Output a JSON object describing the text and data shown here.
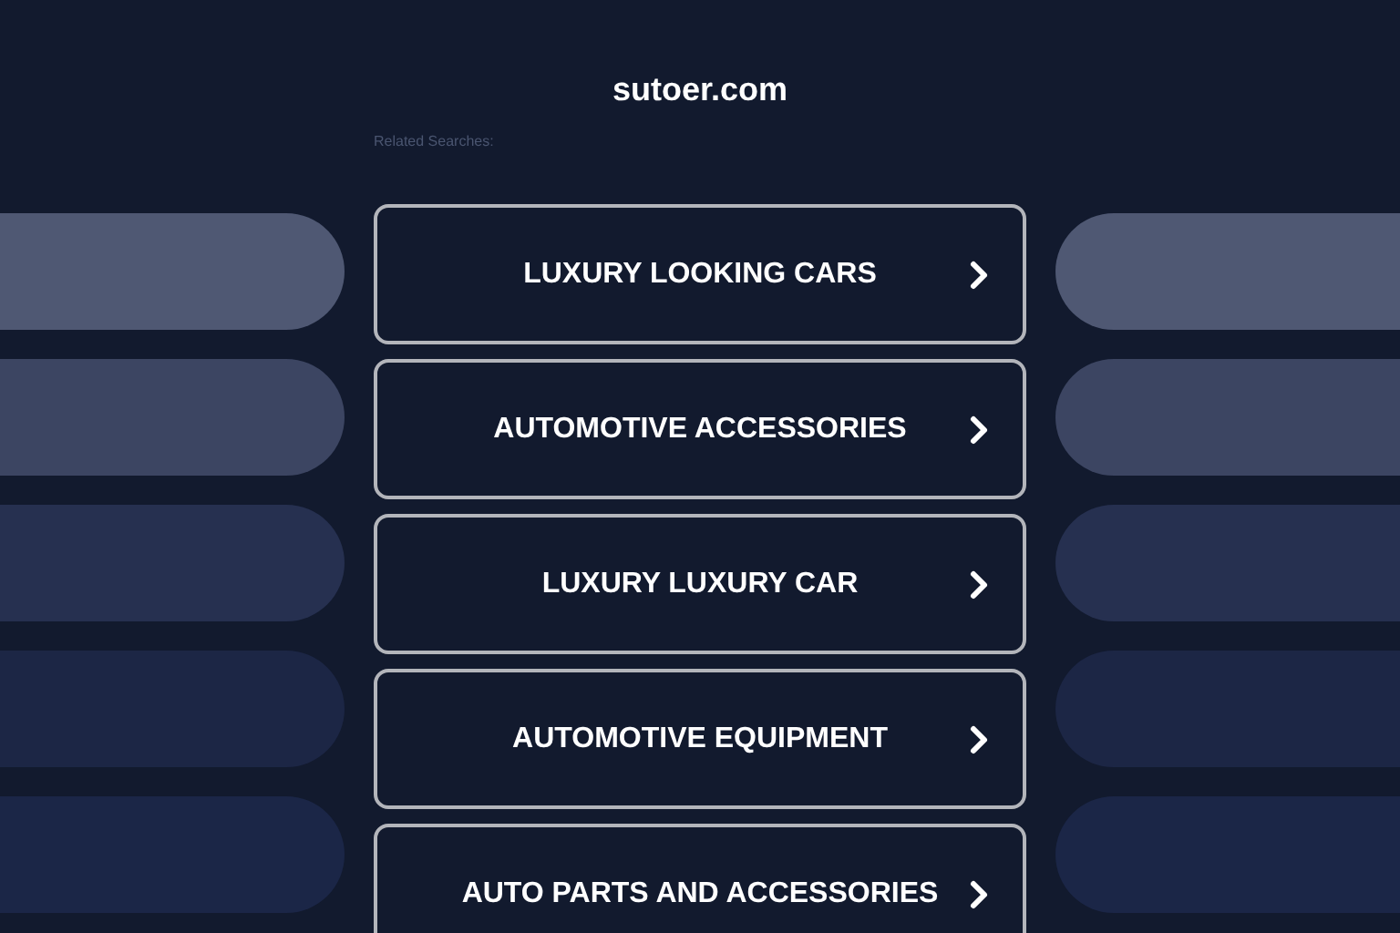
{
  "site_title": "sutoer.com",
  "related_label": "Related Searches:",
  "links": [
    {
      "label": "LUXURY LOOKING CARS"
    },
    {
      "label": "AUTOMOTIVE ACCESSORIES"
    },
    {
      "label": "LUXURY LUXURY CAR"
    },
    {
      "label": "AUTOMOTIVE EQUIPMENT"
    },
    {
      "label": "AUTO PARTS AND ACCESSORIES"
    }
  ]
}
